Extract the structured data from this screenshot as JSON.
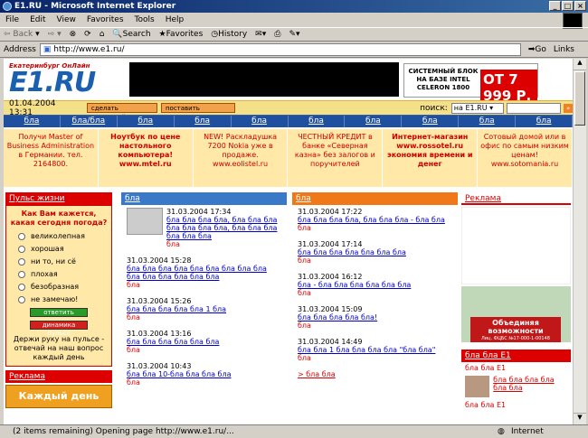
{
  "window": {
    "title": "E1.RU - Microsoft Internet Explorer"
  },
  "menu": [
    "File",
    "Edit",
    "View",
    "Favorites",
    "Tools",
    "Help"
  ],
  "toolbar": {
    "back": "Back",
    "search": "Search",
    "favorites": "Favorites",
    "history": "History"
  },
  "address": {
    "label": "Address",
    "url": "http://www.e1.ru/",
    "go": "Go",
    "links": "Links"
  },
  "site": {
    "logo_caption": "Екатеринбург ОнЛайн",
    "logo_text": "E1.RU",
    "ad_text": "СИСТЕМНЫЙ БЛОК НА БАЗЕ INTEL CELERON 1800",
    "ad_price": "ОТ 7 999 Р.",
    "date": "01.04.2004 13:31",
    "btn_home": "сделать стартовой",
    "btn_bookmark": "поставить закладку",
    "search_label": "поиск:",
    "search_scope": "на E1.RU",
    "nav": [
      "бла",
      "бла/бла",
      "бла",
      "бла",
      "бла",
      "бла",
      "бла",
      "бла",
      "бла",
      "бла"
    ],
    "promos": [
      "Получи Master of Business Administration в Германии. тел. 2164800.",
      "Ноутбук по цене настольного компьютера! www.mtel.ru",
      "NEW! Раскладушка 7200 Nokia уже в продаже. www.eolistel.ru",
      "ЧЕСТНЫЙ КРЕДИТ в банке «Северная казна» без залогов и поручителей",
      "Интернет-магазин www.rossotel.ru экономия времени и денег",
      "Сотовый домой или в офис по самым низким ценам! www.sotomania.ru"
    ],
    "poll": {
      "title": "Пульс жизни",
      "question": "Как Вам кажется, какая сегодня погода?",
      "options": [
        "великолепная",
        "хорошая",
        "ни то, ни сё",
        "плохая",
        "безобразная",
        "не замечаю!"
      ],
      "vote": "ответить",
      "dynamics": "динамика пульса",
      "footer": "Держи руку на пульсе - отвечай на наш вопрос каждый день"
    },
    "left_ad_title": "Реклама",
    "left_ad_banner": "Каждый день",
    "col1": {
      "title": "бла",
      "items": [
        {
          "time": "31.03.2004 17:34",
          "text": "бла бла бла бла, бла бла бла бла бла бла бла, бла бла бла бла бла бла",
          "sub": "бла"
        },
        {
          "time": "31.03.2004 15:28",
          "text": "бла бла бла бла бла бла бла бла бла бла бла бла бла бла бла",
          "sub": "бла"
        },
        {
          "time": "31.03.2004 15:26",
          "text": "бла бла бла бла бла 1 бла",
          "sub": "бла"
        },
        {
          "time": "31.03.2004 13:16",
          "text": "бла бла бла бла бла бла",
          "sub": "бла"
        },
        {
          "time": "31.03.2004 10:43",
          "text": "бла бла 10-бла бла бла бла",
          "sub": "бла"
        }
      ]
    },
    "col2": {
      "title": "бла",
      "items": [
        {
          "time": "31.03.2004 17:22",
          "text": "бла бла бла бла, бла бла бла - бла бла",
          "sub": "бла"
        },
        {
          "time": "31.03.2004 17:14",
          "text": "бла бла бла бла бла бла бла",
          "sub": "бла"
        },
        {
          "time": "31.03.2004 16:12",
          "text": "бла - бла бла бла бла бла бла",
          "sub": "бла"
        },
        {
          "time": "31.03.2004 15:09",
          "text": "бла бла бла бла бла!",
          "sub": "бла"
        },
        {
          "time": "31.03.2004 14:49",
          "text": "бла бла 1 бла бла бла бла \"бла бла\"",
          "sub": "бла"
        }
      ],
      "more": "> бла бла"
    },
    "right": {
      "ad_title": "Реклама",
      "ad_banner": "Объединяя возможности",
      "ad_banner_sub": "Лиц. ФЦБС №17-000-1-00148",
      "section_title": "бла бла E1",
      "section_sub": "бла бла E1",
      "item_text": "бла бла бла бла бла бла",
      "section_sub2": "бла бла E1"
    }
  },
  "status": {
    "text": "(2 items remaining) Opening page http://www.e1.ru/...",
    "zone": "Internet"
  }
}
